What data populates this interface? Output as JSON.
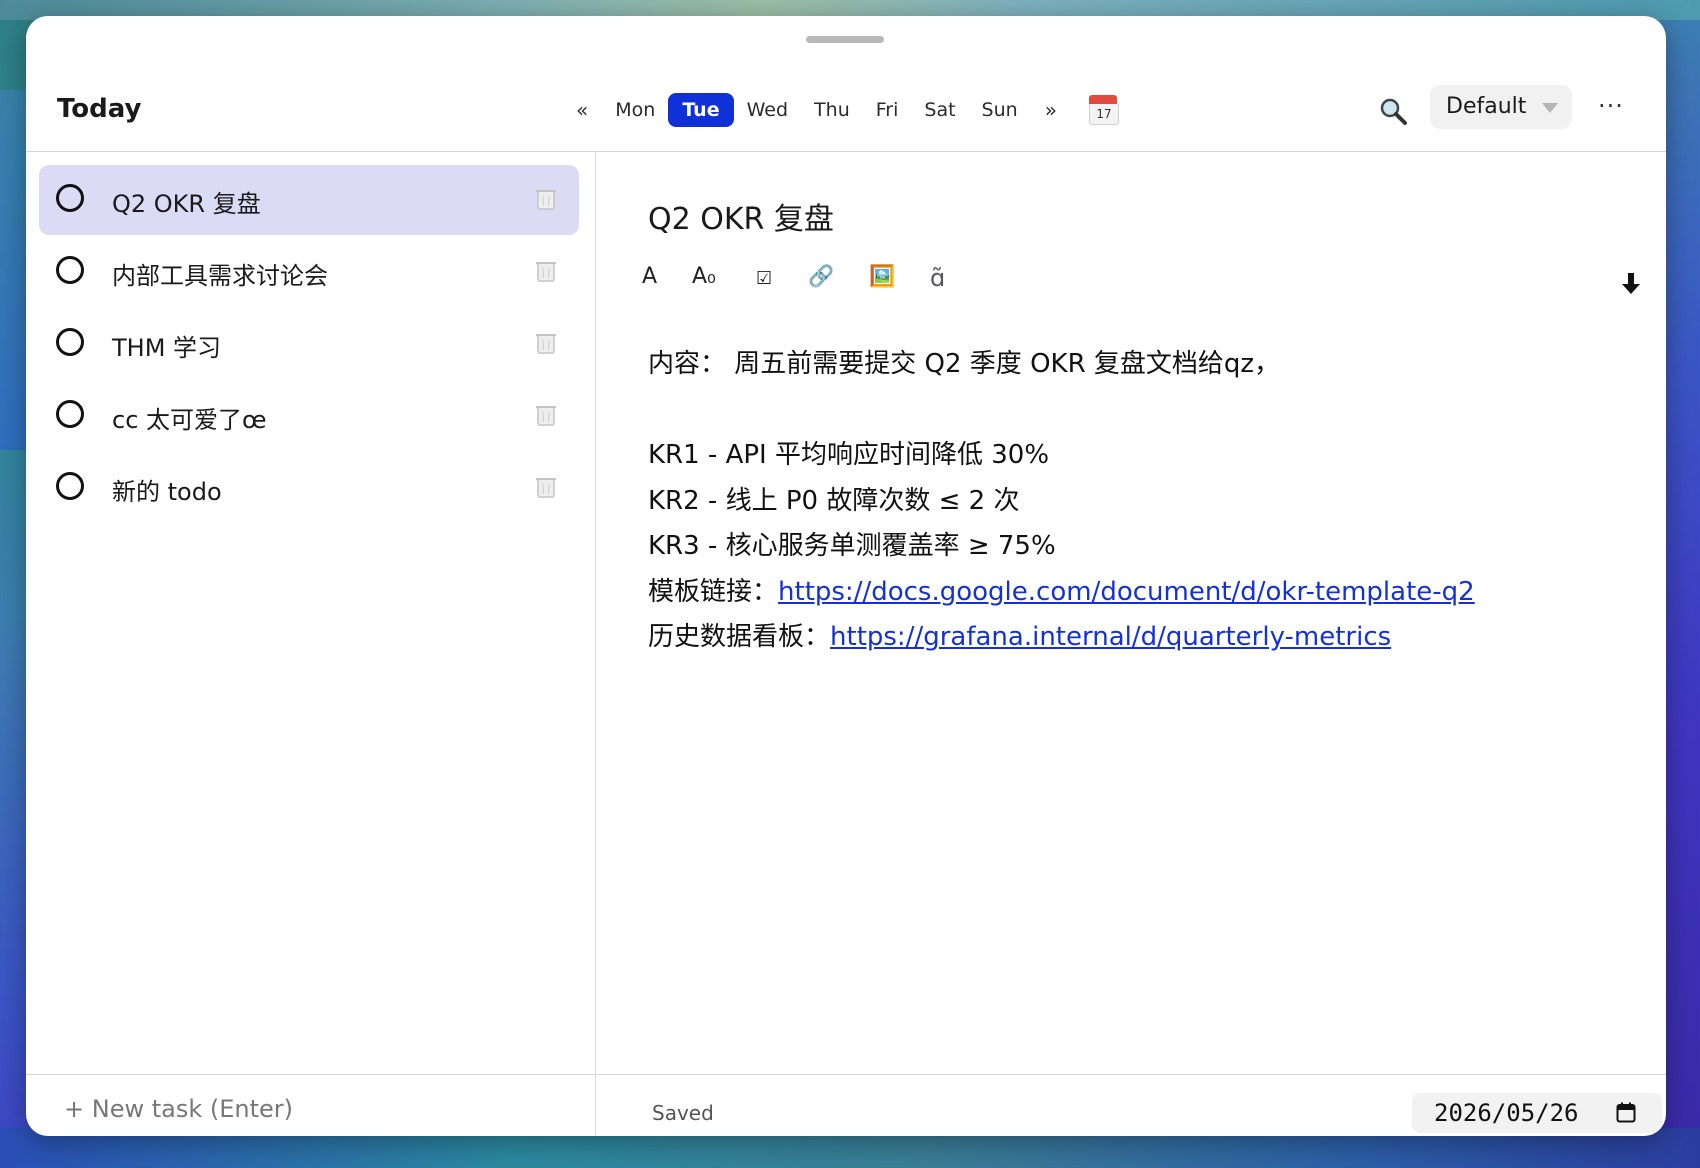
{
  "header": {
    "title": "Today",
    "week": {
      "prev": "«",
      "next": "»",
      "days": [
        "Mon",
        "Tue",
        "Wed",
        "Thu",
        "Fri",
        "Sat",
        "Sun"
      ],
      "active_index": 1
    },
    "calendar_day": "17",
    "profile_label": "Default",
    "more_label": "···"
  },
  "tasks": [
    {
      "label": "Q2 OKR 复盘",
      "selected": true
    },
    {
      "label": "内部工具需求讨论会",
      "selected": false
    },
    {
      "label": "THM 学习",
      "selected": false
    },
    {
      "label": "cc 太可爱了œ",
      "selected": false
    },
    {
      "label": "新的 todo",
      "selected": false
    }
  ],
  "new_task_placeholder": "+ New task (Enter)",
  "detail": {
    "title": "Q2 OKR 复盘",
    "toolbar": {
      "text_style": "A",
      "subscript": "A₀",
      "checkbox": "☑",
      "link": "🔗",
      "image": "🖼️",
      "code": "ɑ̃"
    },
    "lines": [
      {
        "text": "内容： 周五前需要提交 Q2 季度 OKR 复盘文档给qz，"
      },
      {
        "text": ""
      },
      {
        "text": "KR1 - API 平均响应时间降低 30%"
      },
      {
        "text": "KR2 - 线上 P0 故障次数 ≤ 2 次"
      },
      {
        "text": "KR3 - 核心服务单测覆盖率 ≥ 75%"
      },
      {
        "text": "模板链接：",
        "link": "https://docs.google.com/document/d/okr-template-q2 "
      },
      {
        "text": "历史数据看板：",
        "link": "https://grafana.internal/d/quarterly-metrics"
      }
    ],
    "status": "Saved",
    "date": "2026/05/26"
  },
  "colors": {
    "accent": "#1030d8",
    "selected_row": "#dcdbf6",
    "link": "#1431d8"
  }
}
